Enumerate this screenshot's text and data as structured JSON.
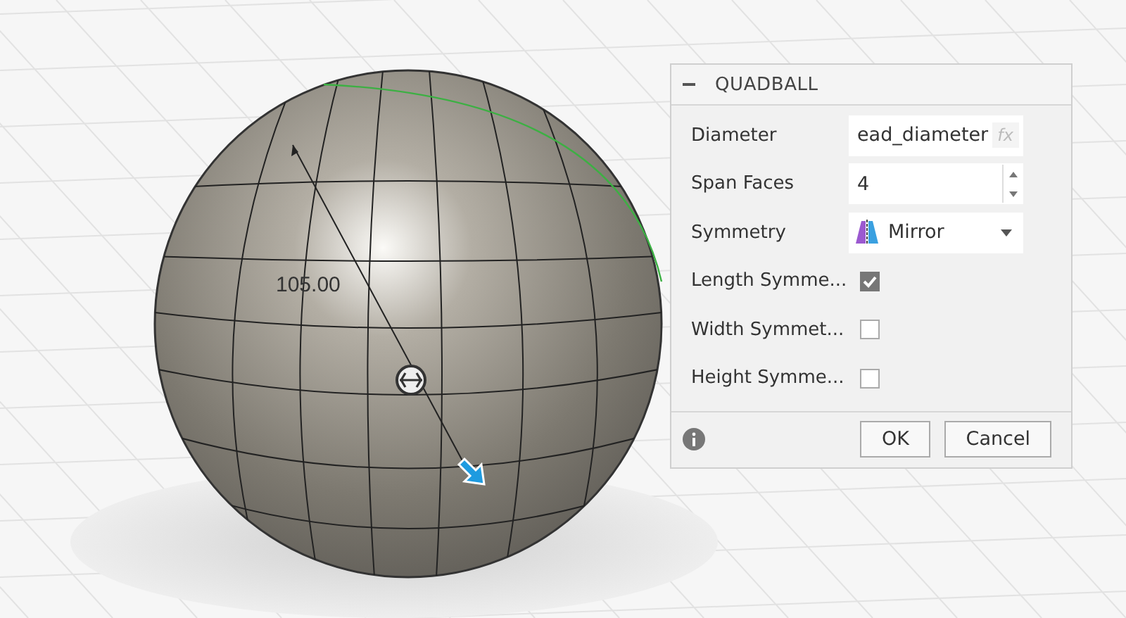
{
  "viewport": {
    "dimension_label": "105.00"
  },
  "dialog": {
    "title": "QUADBALL",
    "expanded": true,
    "rows": [
      {
        "kind": "expression",
        "label": "Diameter",
        "value": "ead_diameter",
        "suffix": "fx"
      },
      {
        "kind": "spinner",
        "label": "Span Faces",
        "value": "4"
      },
      {
        "kind": "dropdown",
        "label": "Symmetry",
        "value": "Mirror"
      },
      {
        "kind": "checkbox",
        "label": "Length Symme...",
        "checked": true
      },
      {
        "kind": "checkbox",
        "label": "Width Symmet...",
        "checked": false
      },
      {
        "kind": "checkbox",
        "label": "Height Symme...",
        "checked": false
      }
    ],
    "buttons": [
      {
        "label": "OK"
      },
      {
        "label": "Cancel"
      }
    ]
  }
}
